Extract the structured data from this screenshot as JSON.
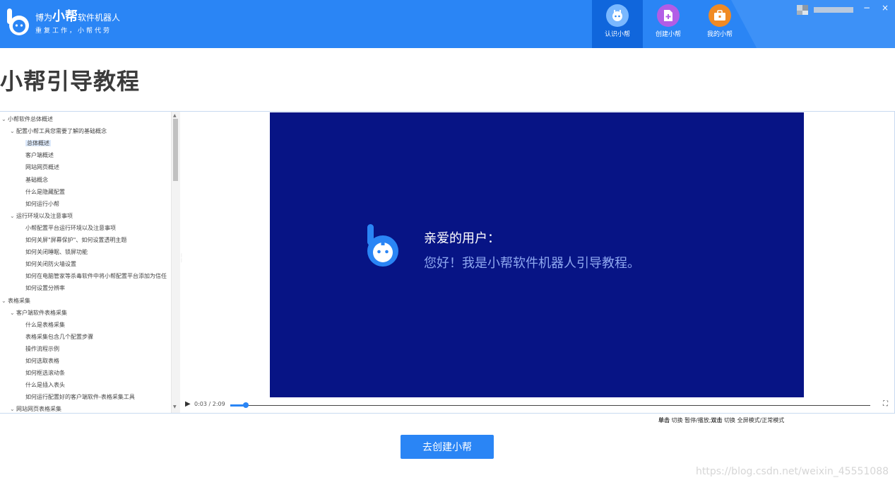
{
  "header": {
    "brand_prefix": "博为",
    "brand_bold": "小帮",
    "brand_suffix": "软件机器人",
    "slogan": "重复工作，小帮代劳",
    "tabs": [
      {
        "label": "认识小帮",
        "icon": "robot-face-icon",
        "active": true
      },
      {
        "label": "创建小帮",
        "icon": "document-add-icon",
        "active": false
      },
      {
        "label": "我的小帮",
        "icon": "briefcase-icon",
        "active": false
      }
    ],
    "window": {
      "minimize": "−",
      "close": "×"
    }
  },
  "page_title": "小帮引导教程",
  "tree": [
    {
      "label": "小帮软件总体概述",
      "level": 0,
      "expanded": true
    },
    {
      "label": "配置小帮工具您需要了解的基础概念",
      "level": 1,
      "expanded": true
    },
    {
      "label": "总体概述",
      "level": 2,
      "selected": true
    },
    {
      "label": "客户端概述",
      "level": 2
    },
    {
      "label": "网站网页概述",
      "level": 2
    },
    {
      "label": "基础概念",
      "level": 2
    },
    {
      "label": "什么是隐藏配置",
      "level": 2
    },
    {
      "label": "如何运行小帮",
      "level": 2
    },
    {
      "label": "运行环境以及注意事项",
      "level": 1,
      "expanded": true
    },
    {
      "label": "小帮配置平台运行环境以及注意事项",
      "level": 2
    },
    {
      "label": "如何关屏\"屏幕保护\"、如何设置透明主题",
      "level": 2
    },
    {
      "label": "如何关闭睡眠、锁屏功能",
      "level": 2
    },
    {
      "label": "如何关闭防火墙设置",
      "level": 2
    },
    {
      "label": "如何在电脑管家等杀毒软件中将小帮配置平台添加为信任",
      "level": 2
    },
    {
      "label": "如何设置分辨率",
      "level": 2
    },
    {
      "label": "表格采集",
      "level": 0,
      "expanded": true
    },
    {
      "label": "客户端软件表格采集",
      "level": 1,
      "expanded": true
    },
    {
      "label": "什么是表格采集",
      "level": 2
    },
    {
      "label": "表格采集包含几个配置步骤",
      "level": 2
    },
    {
      "label": "操作流程示例",
      "level": 2
    },
    {
      "label": "如何选取表格",
      "level": 2
    },
    {
      "label": "如何框选滚动条",
      "level": 2
    },
    {
      "label": "什么是插入表头",
      "level": 2
    },
    {
      "label": "如何运行配置好的客户端软件-表格采集工具",
      "level": 2
    },
    {
      "label": "网站网页表格采集",
      "level": 1,
      "expanded": true
    }
  ],
  "video": {
    "greeting_title": "亲爱的用户：",
    "greeting_body": "您好！我是小帮软件机器人引导教程。",
    "time": "0:03 / 2:09",
    "progress": 0.024
  },
  "hint": {
    "part1": "单击",
    "part2": " 切换 暂停/播放;",
    "part3": "双击",
    "part4": " 切换 全屏模式/正常模式"
  },
  "cta_label": "去创建小帮",
  "watermark": "https://blog.csdn.net/weixin_45551088",
  "colors": {
    "accent": "#2a85f5",
    "video_bg": "#071485",
    "tab_active": "#1066dc"
  }
}
